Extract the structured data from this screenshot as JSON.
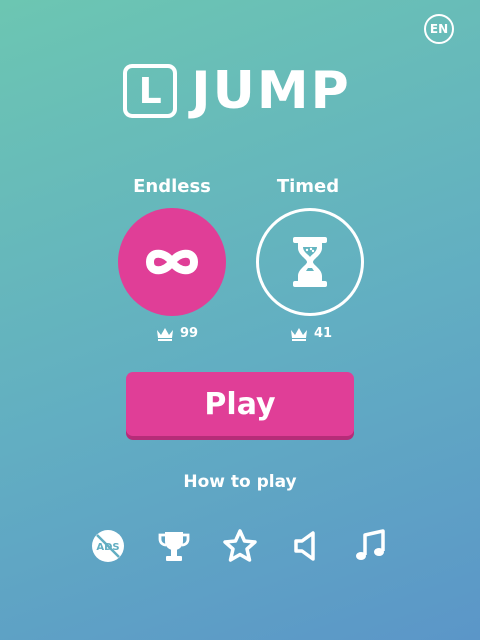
{
  "language": {
    "label": "EN"
  },
  "logo": {
    "letter": "L",
    "word": "JUMP"
  },
  "modes": [
    {
      "label": "Endless",
      "icon": "infinity-icon",
      "best_score": "99"
    },
    {
      "label": "Timed",
      "icon": "hourglass-icon",
      "best_score": "41"
    }
  ],
  "play_button": {
    "label": "Play"
  },
  "how_to_play": {
    "label": "How to play"
  },
  "bottom_icons": [
    "no-ads-icon",
    "trophy-icon",
    "star-icon",
    "sound-icon",
    "music-note-icon"
  ],
  "colors": {
    "accent": "#e03e97",
    "accent_shadow": "#b62c78",
    "background_top": "#6cc6b2",
    "background_bottom": "#5b96c8",
    "foreground": "#ffffff"
  }
}
